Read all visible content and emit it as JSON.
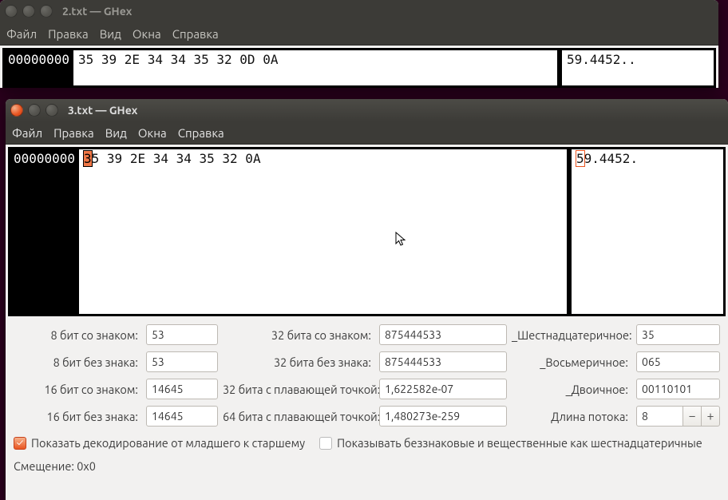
{
  "windows": {
    "primary": {
      "title": "2.txt — GHex"
    },
    "secondary": {
      "title": "3.txt — GHex"
    }
  },
  "menu": {
    "file": "Файл",
    "edit": "Правка",
    "view": "Вид",
    "windows": "Окна",
    "help": "Справка"
  },
  "hex1": {
    "offset": "00000000",
    "bytes": "35 39 2E 34 34 35 32 0D 0A",
    "ascii": "59.4452.."
  },
  "hex2": {
    "offset": "00000000",
    "sel_nibble": "3",
    "rest_first": "5",
    "rest_bytes": " 39 2E 34 34 35 32 0A",
    "ascii_sel": "5",
    "ascii_rest": "9.4452."
  },
  "info": {
    "labels": {
      "s8": "8 бит со знаком:",
      "u8": "8 бит без знака:",
      "s16": "16 бит со знаком:",
      "u16": "16 бит без знака:",
      "s32": "32 бита со знаком:",
      "u32": "32 бита без знака:",
      "f32": "32 бита с плавающей точкой:",
      "f64": "64 бита с плавающей точкой:",
      "hex": "_Шестнадцатеричное:",
      "oct": "_Восьмеричное:",
      "bin": "_Двоичное:",
      "stream": "Длина потока:"
    },
    "values": {
      "s8": "53",
      "u8": "53",
      "s16": "14645",
      "u16": "14645",
      "s32": "875444533",
      "u32": "875444533",
      "f32": "1,622582e-07",
      "f64": "1,480273e-259",
      "hex": "35",
      "oct": "065",
      "bin": "00110101",
      "stream": "8"
    },
    "checkboxes": {
      "little_endian": "Показать декодирование от младшего к старшему",
      "unsigned_as_hex": "Показывать беззнаковые и вещественные как шестнадцатеричные"
    },
    "offset_label": "Смещение: 0x0"
  }
}
